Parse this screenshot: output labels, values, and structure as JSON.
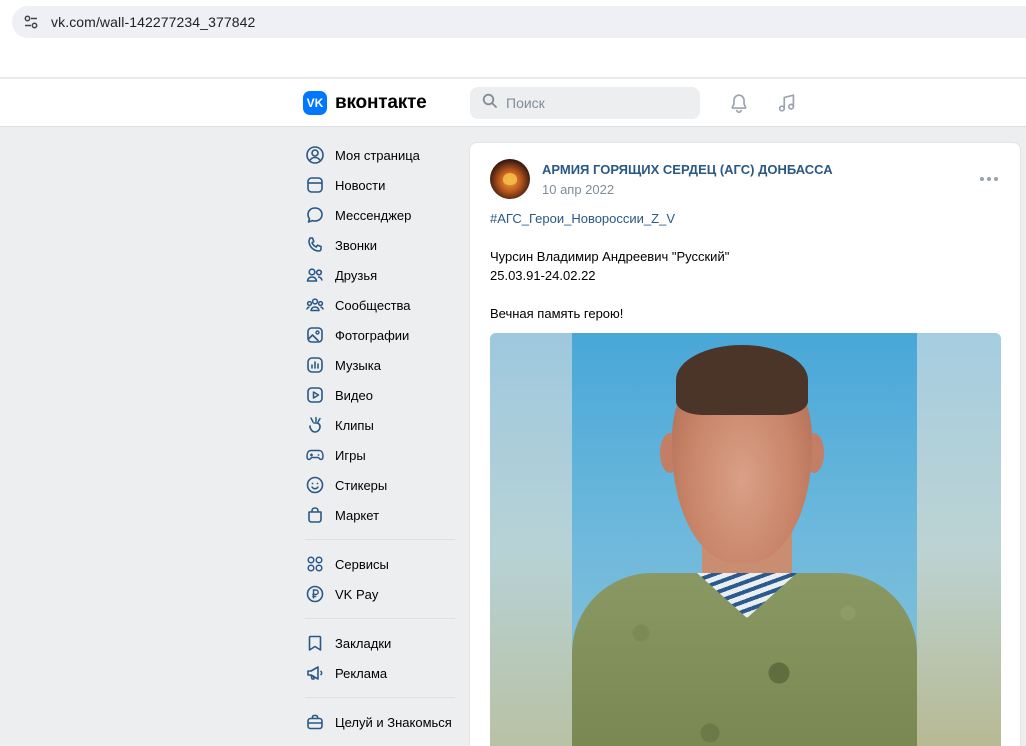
{
  "browser": {
    "url": "vk.com/wall-142277234_377842",
    "site_icon": "tune-icon"
  },
  "header": {
    "logo_badge": "VK",
    "logo_word": "вконтакте",
    "search_placeholder": "Поиск",
    "icons": [
      "bell-icon",
      "music-icon"
    ]
  },
  "sidebar": {
    "groups": [
      [
        {
          "label": "Моя страница",
          "icon": "user-circle-icon"
        },
        {
          "label": "Новости",
          "icon": "news-icon"
        },
        {
          "label": "Мессенджер",
          "icon": "chat-bubble-icon"
        },
        {
          "label": "Звонки",
          "icon": "phone-icon"
        },
        {
          "label": "Друзья",
          "icon": "friends-icon"
        },
        {
          "label": "Сообщества",
          "icon": "communities-icon"
        },
        {
          "label": "Фотографии",
          "icon": "photo-icon"
        },
        {
          "label": "Музыка",
          "icon": "music-icon"
        },
        {
          "label": "Видео",
          "icon": "video-icon"
        },
        {
          "label": "Клипы",
          "icon": "clips-icon"
        },
        {
          "label": "Игры",
          "icon": "gamepad-icon"
        },
        {
          "label": "Стикеры",
          "icon": "sticker-icon"
        },
        {
          "label": "Маркет",
          "icon": "market-bag-icon"
        }
      ],
      [
        {
          "label": "Сервисы",
          "icon": "services-grid-icon"
        },
        {
          "label": "VK Pay",
          "icon": "vkpay-icon"
        }
      ],
      [
        {
          "label": "Закладки",
          "icon": "bookmark-icon"
        },
        {
          "label": "Реклама",
          "icon": "megaphone-icon"
        }
      ],
      [
        {
          "label": "Целуй и Знакомься",
          "icon": "briefcase-icon"
        }
      ]
    ]
  },
  "post": {
    "group_name": "АРМИЯ ГОРЯЩИХ СЕРДЕЦ (АГС) ДОНБАССА",
    "date": "10 апр 2022",
    "hashtag": "#АГС_Герои_Новороссии_Z_V",
    "name_line": "Чурсин Владимир Андреевич \"Русский\"",
    "dates_line": "25.03.91-24.02.22",
    "memory_line": "Вечная память герою!"
  }
}
